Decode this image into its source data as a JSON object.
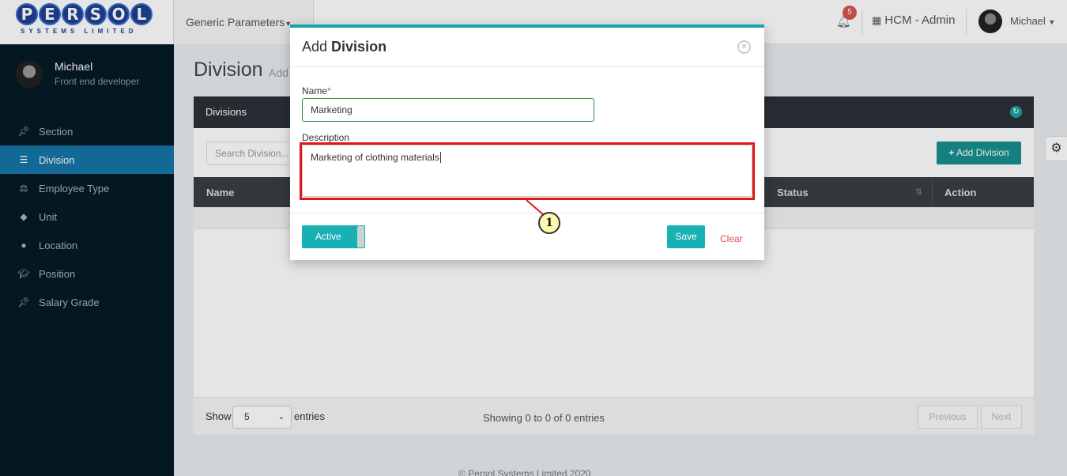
{
  "brand": {
    "logo_letters": [
      "P",
      "E",
      "R",
      "S",
      "O",
      "L"
    ],
    "logo_sub": "SYSTEMS LIMITED"
  },
  "topbar": {
    "module_menu": "Generic Parameters",
    "notification_count": "5",
    "app_label": "HCM - Admin",
    "user_name": "Michael"
  },
  "sidebar": {
    "user_name": "Michael",
    "user_role": "Front end developer",
    "items": [
      {
        "label": "Section",
        "icon": "pin-icon"
      },
      {
        "label": "Division",
        "icon": "list-icon"
      },
      {
        "label": "Employee Type",
        "icon": "balance-icon"
      },
      {
        "label": "Unit",
        "icon": "tag-icon"
      },
      {
        "label": "Location",
        "icon": "map-pin-icon"
      },
      {
        "label": "Position",
        "icon": "graduation-cap-icon"
      },
      {
        "label": "Salary Grade",
        "icon": "pin-icon"
      }
    ],
    "active_index": 1
  },
  "main": {
    "title": "Division",
    "title_sub": "Add",
    "card_title": "Divisions",
    "search_placeholder": "Search Division...",
    "add_button": "Add Division",
    "columns": {
      "name": "Name",
      "status": "Status",
      "action": "Action"
    },
    "show_label": "Show",
    "page_size": "5",
    "entries_label": "entries",
    "showing_text": "Showing 0 to 0 of 0 entries",
    "prev_label": "Previous",
    "next_label": "Next"
  },
  "footer": "© Persol Systems Limited 2020",
  "modal": {
    "title_prefix": "Add",
    "title_bold": "Division",
    "name_label": "Name",
    "required_mark": "*",
    "name_value": "Marketing",
    "description_label": "Description",
    "description_value": "Marketing of clothing materials",
    "active_label": "Active",
    "save_label": "Save",
    "clear_label": "Clear"
  },
  "annotation": {
    "step_number": "1",
    "highlight_color": "#e0161b"
  },
  "colors": {
    "accent_teal": "#17b0b3",
    "sidebar_bg": "#061b25",
    "sidebar_active": "#1675a8",
    "badge_red": "#d9534f"
  }
}
